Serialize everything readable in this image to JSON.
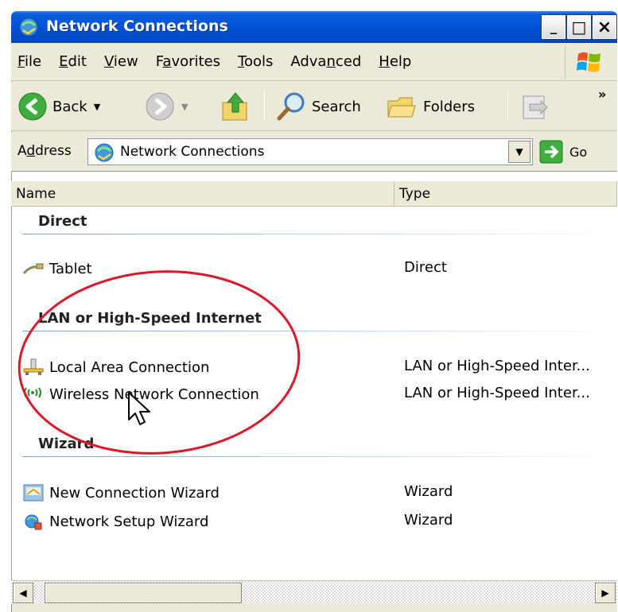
{
  "window": {
    "title": "Network Connections",
    "minimize": "_",
    "maximize": "□",
    "close": "×"
  },
  "menu": [
    {
      "underline": "F",
      "rest": "ile"
    },
    {
      "underline": "E",
      "rest": "dit"
    },
    {
      "underline": "V",
      "rest": "iew"
    },
    {
      "pre": "F",
      "underline": "a",
      "rest": "vorites"
    },
    {
      "underline": "T",
      "rest": "ools"
    },
    {
      "pre": "Adva",
      "underline": "n",
      "rest": "ced"
    },
    {
      "underline": "H",
      "rest": "elp"
    }
  ],
  "toolbar": {
    "back_label": "Back",
    "search_label": "Search",
    "folders_label": "Folders",
    "more": "»"
  },
  "address": {
    "label_pre": "A",
    "label_underline": "d",
    "label_rest": "dress",
    "value": "Network Connections",
    "go_label": "Go"
  },
  "columns": {
    "name": "Name",
    "type": "Type"
  },
  "groups": {
    "direct": "Direct",
    "lan": "LAN or High-Speed Internet",
    "wizard": "Wizard"
  },
  "rows": {
    "tablet": {
      "name": "Tablet",
      "type": "Direct"
    },
    "local": {
      "name": "Local Area Connection",
      "type": "LAN or High-Speed Inter..."
    },
    "wireless": {
      "name": "Wireless Network Connection",
      "type": "LAN or High-Speed Inter..."
    },
    "newconn": {
      "name": "New Connection Wizard",
      "type": "Wizard"
    },
    "setup": {
      "name": "Network Setup Wizard",
      "type": "Wizard"
    }
  },
  "colors": {
    "titlebar": "#0052d6",
    "chrome": "#ece9d8",
    "annotation": "#d91a2a"
  }
}
